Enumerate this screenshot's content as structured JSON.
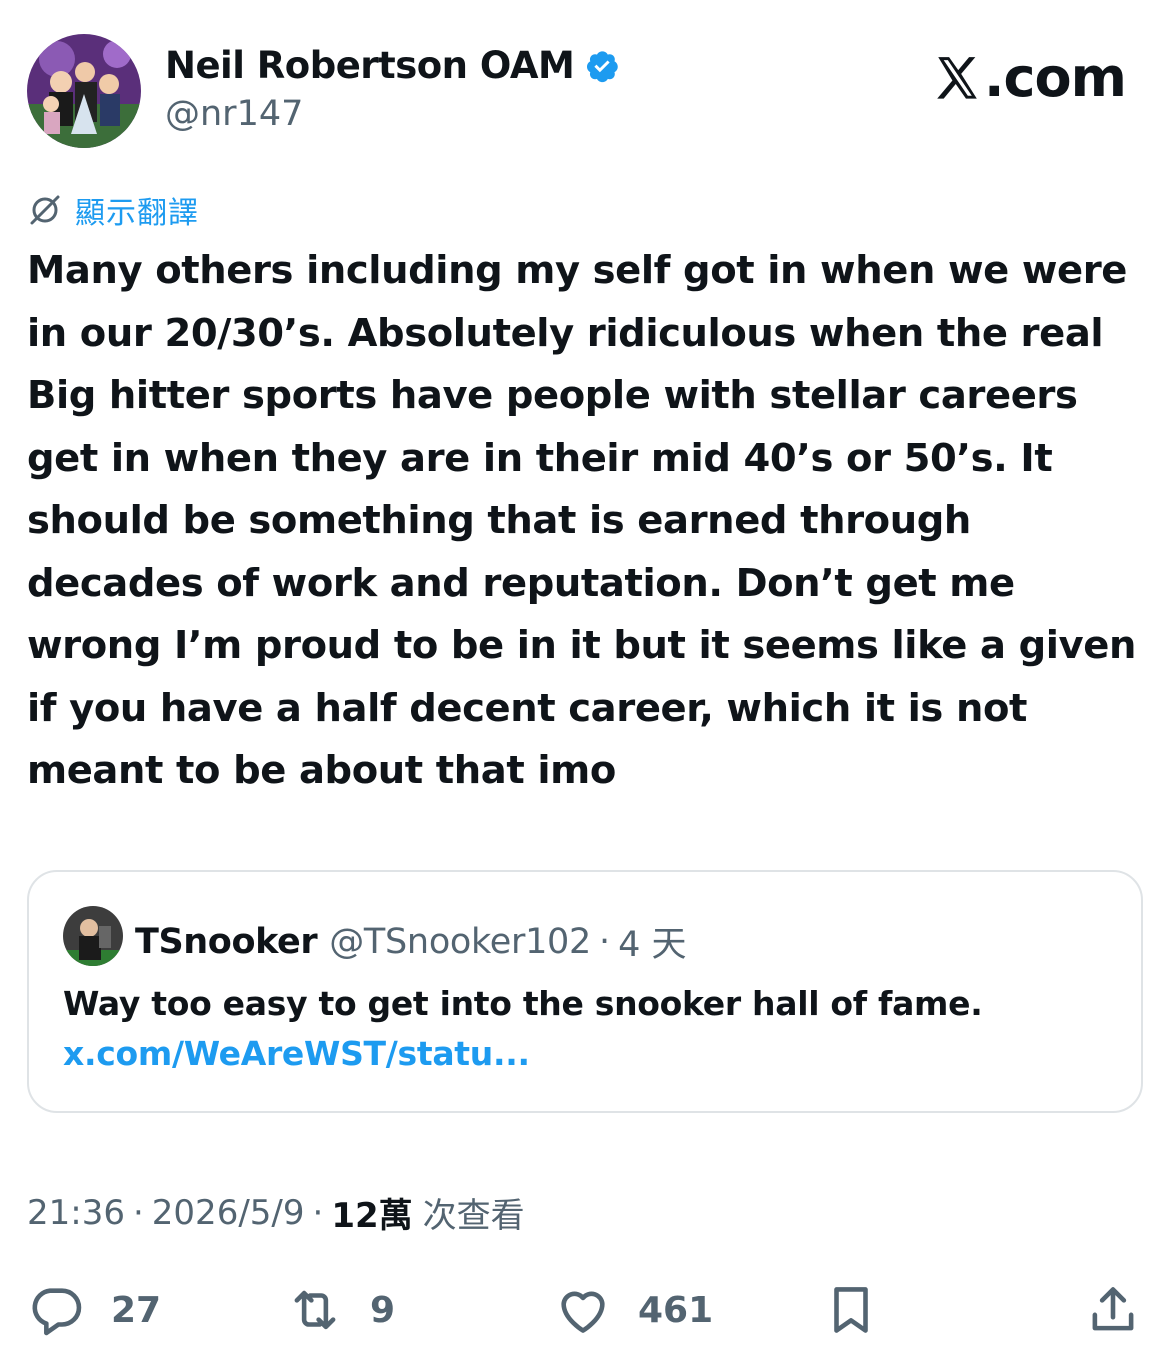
{
  "author": {
    "name": "Neil Robertson OAM",
    "handle": "@nr147",
    "verified": true
  },
  "brand": {
    "text": ".com",
    "icon": "x-logo-icon"
  },
  "translate": {
    "label": "顯示翻譯",
    "icon": "translate-icon"
  },
  "tweet": {
    "text": "Many others including my self got in when we were\nin our 20/30’s.  Absolutely ridiculous when the real\nBig hitter sports have people with stellar careers\nget in when they are in their mid 40’s or 50’s. It\nshould be something that is earned through\ndecades of work and reputation. Don’t get me\nwrong I’m proud to be in it but it seems like a given\nif you have a half decent career, which it is not\nmeant to be about that imo"
  },
  "quote": {
    "name": "TSnooker",
    "handle": "@TSnooker102",
    "separator": "·",
    "time": "4 天",
    "text": "Way too easy to get into the snooker hall of fame.",
    "link": "x.com/WeAreWST/statu..."
  },
  "meta": {
    "time": "21:36",
    "separator": "·",
    "date": "2026/5/9",
    "views": "12萬",
    "views_label": "次查看"
  },
  "actions": {
    "replies": "27",
    "reposts": "9",
    "likes": "461"
  },
  "colors": {
    "accent": "#1d9bf0",
    "text": "#0f1419",
    "secondary": "#536471",
    "border": "#dfe3e6"
  }
}
